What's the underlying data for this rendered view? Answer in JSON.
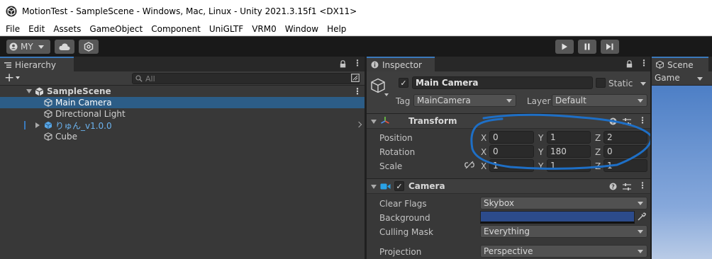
{
  "window": {
    "title": "MotionTest - SampleScene - Windows, Mac, Linux - Unity 2021.3.15f1 <DX11>"
  },
  "menu": [
    "File",
    "Edit",
    "Assets",
    "GameObject",
    "Component",
    "UniGLTF",
    "VRM0",
    "Window",
    "Help"
  ],
  "toolbar": {
    "account_label": "MY"
  },
  "hierarchy": {
    "tab_label": "Hierarchy",
    "search_placeholder": "All",
    "scene_name": "SampleScene",
    "items": [
      "Main Camera",
      "Directional Light",
      "りゅん_v1.0.0",
      "Cube"
    ]
  },
  "inspector": {
    "tab_label": "Inspector",
    "object_name": "Main Camera",
    "static_label": "Static",
    "tag_label": "Tag",
    "tag_value": "MainCamera",
    "layer_label": "Layer",
    "layer_value": "Default",
    "transform": {
      "title": "Transform",
      "position_label": "Position",
      "rotation_label": "Rotation",
      "scale_label": "Scale",
      "axis_x": "X",
      "axis_y": "Y",
      "axis_z": "Z",
      "position": {
        "x": "0",
        "y": "1",
        "z": "2"
      },
      "rotation": {
        "x": "0",
        "y": "180",
        "z": "0"
      },
      "scale": {
        "x": "1",
        "y": "1",
        "z": "1"
      }
    },
    "camera": {
      "title": "Camera",
      "clear_flags_label": "Clear Flags",
      "clear_flags_value": "Skybox",
      "background_label": "Background",
      "background_color": "#2c4b8b",
      "culling_mask_label": "Culling Mask",
      "culling_mask_value": "Everything",
      "projection_label": "Projection",
      "projection_value": "Perspective"
    }
  },
  "scene": {
    "tab_label": "Scene",
    "mode_label": "Game"
  },
  "colors": {
    "selection": "#2c5d87",
    "annotation": "#1e6fc6",
    "prefab": "#58a6e6"
  }
}
